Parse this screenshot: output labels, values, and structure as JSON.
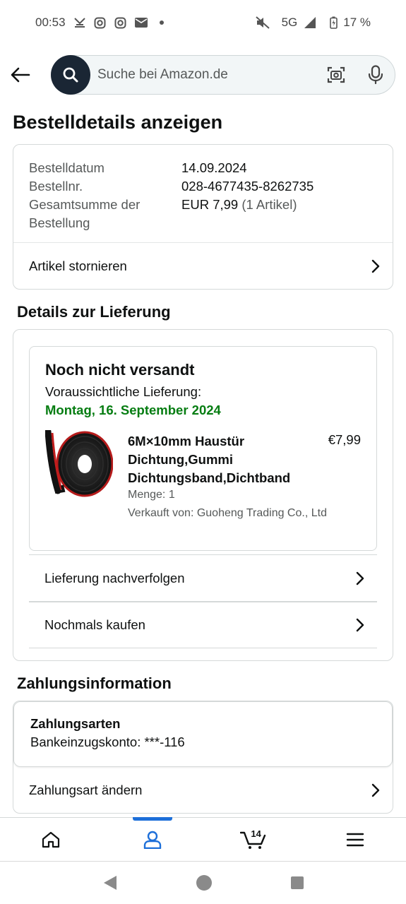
{
  "status_bar": {
    "time": "00:53",
    "network": "5G",
    "battery": "17 %"
  },
  "search": {
    "placeholder": "Suche bei Amazon.de"
  },
  "page": {
    "title": "Bestelldetails anzeigen"
  },
  "order_summary": {
    "rows": [
      {
        "label": "Bestelldatum",
        "value": "14.09.2024"
      },
      {
        "label": "Bestellnr.",
        "value": "028-4677435-8262735"
      },
      {
        "label": "Gesamtsumme der Bestellung",
        "value": "EUR 7,99",
        "extra": "(1 Artikel)"
      }
    ],
    "cancel_label": "Artikel stornieren"
  },
  "delivery": {
    "section_title": "Details zur Lieferung",
    "status": "Noch nicht versandt",
    "eta_label": "Voraussichtliche Lieferung:",
    "eta_date": "Montag, 16. September 2024",
    "product": {
      "title": "6M×10mm Haustür Dichtung,Gummi Dichtungsband,Dichtband",
      "price": "€7,99",
      "quantity": "Menge: 1",
      "seller": "Verkauft von: Guoheng Trading Co., Ltd"
    },
    "track_label": "Lieferung nachverfolgen",
    "buy_again_label": "Nochmals kaufen"
  },
  "payment": {
    "section_title": "Zahlungsinformation",
    "method_title": "Zahlungsarten",
    "method_value": "Bankeinzugskonto: ***-116",
    "change_label": "Zahlungsart ändern"
  },
  "bottom_nav": {
    "cart_count": "14",
    "active": "account"
  },
  "colors": {
    "accent_blue": "#1d6fd9",
    "eta_green": "#067d12",
    "search_button": "#1a2634"
  },
  "icons": [
    "missed-call-icon",
    "instagram-icon",
    "mail-icon",
    "mute-icon",
    "signal-icon",
    "battery-icon",
    "back-arrow-icon",
    "search-icon",
    "camera-icon",
    "mic-icon",
    "chevron-right-icon",
    "home-icon",
    "account-icon",
    "cart-icon",
    "menu-icon"
  ]
}
